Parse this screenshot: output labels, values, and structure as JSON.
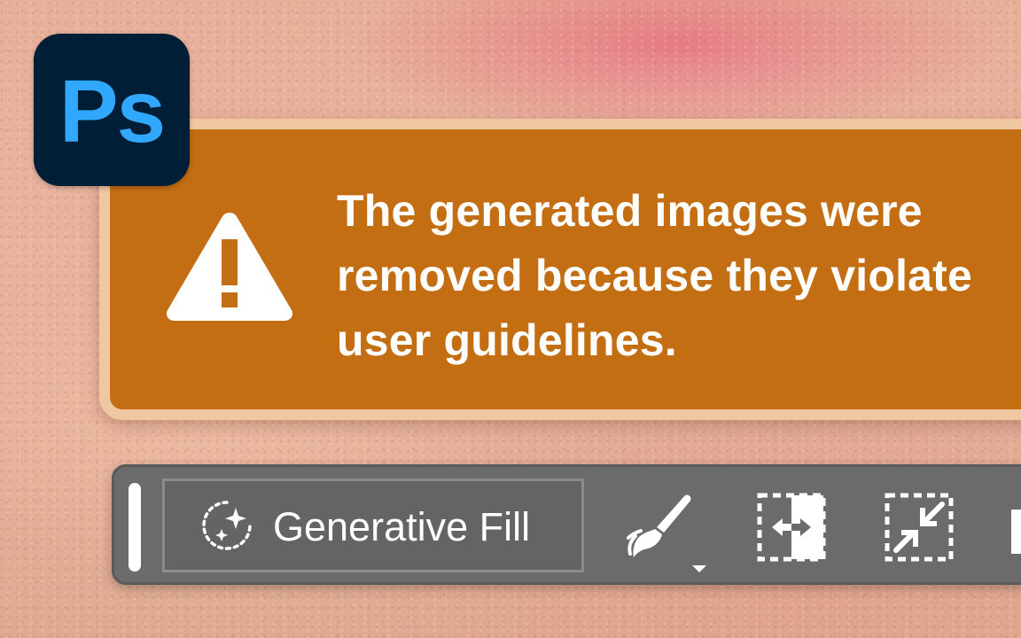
{
  "app": {
    "logo_text": "Ps",
    "logo_icon": "photoshop-logo"
  },
  "alert": {
    "icon": "warning-triangle-icon",
    "message": "The generated images were removed because they violate user guidelines.",
    "colors": {
      "background": "#c46e13",
      "border": "#efc7a1",
      "text": "#ffffff"
    }
  },
  "toolbar": {
    "generative_fill_label": "Generative Fill",
    "generative_fill_icon": "generative-fill-sparkle-icon",
    "tools": [
      {
        "icon": "brush-icon",
        "has_dropdown": true
      },
      {
        "icon": "swap-selection-icon"
      },
      {
        "icon": "shrink-selection-icon"
      }
    ],
    "colors": {
      "background": "#6b6b6b",
      "icon": "#ffffff"
    }
  }
}
